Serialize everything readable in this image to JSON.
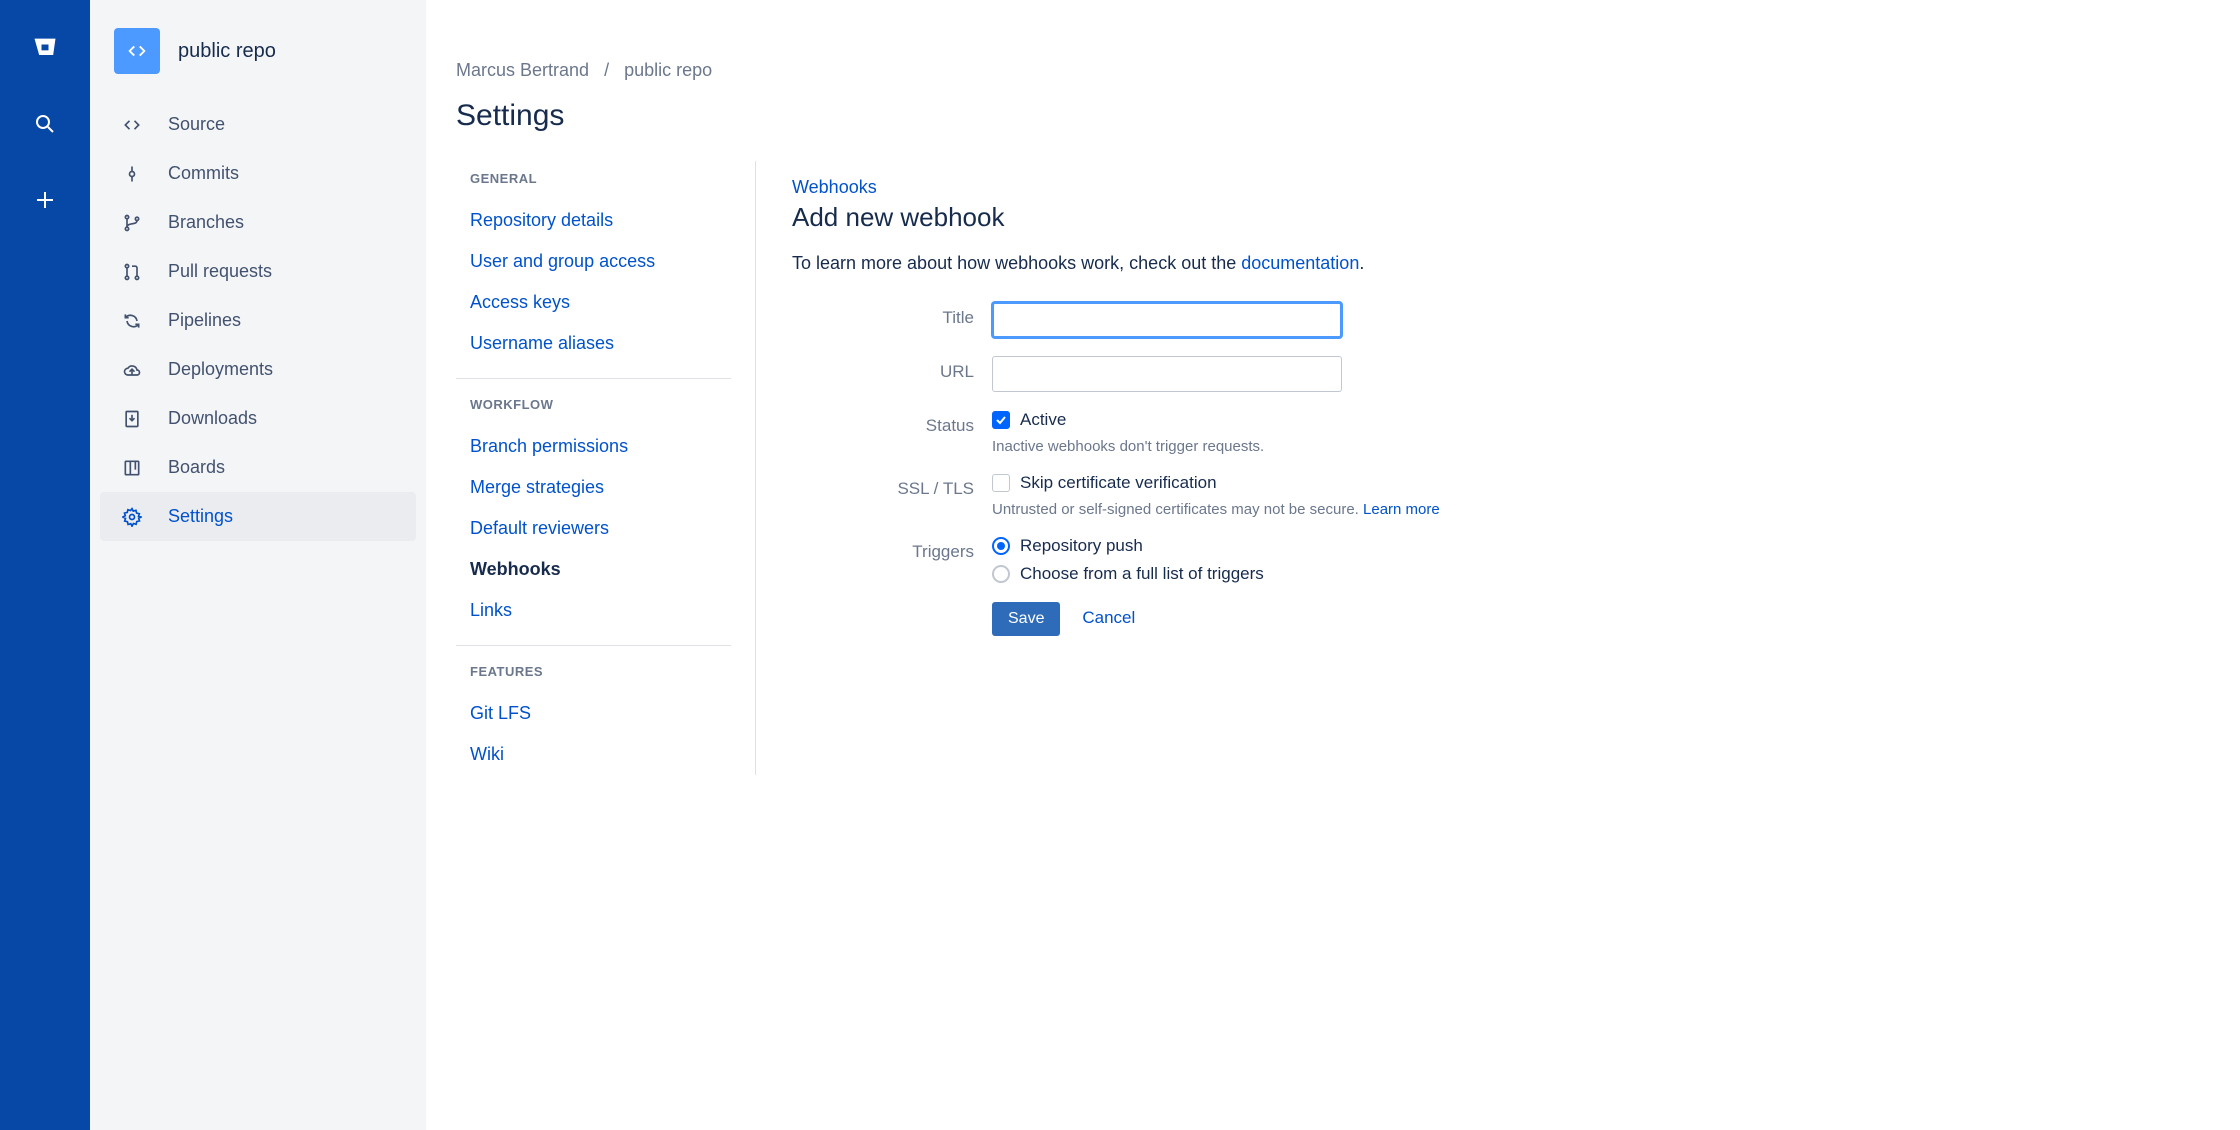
{
  "global_nav": {
    "logo": "bitbucket-logo",
    "items": [
      "search-icon",
      "plus-icon"
    ]
  },
  "repo": {
    "name": "public repo",
    "nav": [
      {
        "id": "source",
        "label": "Source",
        "icon": "code-icon"
      },
      {
        "id": "commits",
        "label": "Commits",
        "icon": "commit-icon"
      },
      {
        "id": "branches",
        "label": "Branches",
        "icon": "branch-icon"
      },
      {
        "id": "pullrequests",
        "label": "Pull requests",
        "icon": "pull-request-icon"
      },
      {
        "id": "pipelines",
        "label": "Pipelines",
        "icon": "pipeline-icon"
      },
      {
        "id": "deployments",
        "label": "Deployments",
        "icon": "cloud-upload-icon"
      },
      {
        "id": "downloads",
        "label": "Downloads",
        "icon": "download-icon"
      },
      {
        "id": "boards",
        "label": "Boards",
        "icon": "board-icon"
      },
      {
        "id": "settings",
        "label": "Settings",
        "icon": "gear-icon",
        "active": true
      }
    ]
  },
  "breadcrumb": {
    "owner": "Marcus Bertrand",
    "repo": "public repo"
  },
  "page_title": "Settings",
  "settings_nav": {
    "groups": [
      {
        "title": "GENERAL",
        "items": [
          {
            "id": "repo-details",
            "label": "Repository details"
          },
          {
            "id": "user-group-access",
            "label": "User and group access"
          },
          {
            "id": "access-keys",
            "label": "Access keys"
          },
          {
            "id": "username-aliases",
            "label": "Username aliases"
          }
        ]
      },
      {
        "title": "WORKFLOW",
        "items": [
          {
            "id": "branch-permissions",
            "label": "Branch permissions"
          },
          {
            "id": "merge-strategies",
            "label": "Merge strategies"
          },
          {
            "id": "default-reviewers",
            "label": "Default reviewers"
          },
          {
            "id": "webhooks",
            "label": "Webhooks",
            "current": true
          },
          {
            "id": "links",
            "label": "Links"
          }
        ]
      },
      {
        "title": "FEATURES",
        "items": [
          {
            "id": "git-lfs",
            "label": "Git LFS"
          },
          {
            "id": "wiki",
            "label": "Wiki"
          }
        ]
      }
    ]
  },
  "content": {
    "parent_link": "Webhooks",
    "heading": "Add new webhook",
    "help_prefix": "To learn more about how webhooks work, check out the ",
    "help_link": "documentation",
    "help_suffix": ".",
    "form": {
      "title_label": "Title",
      "title_value": "",
      "url_label": "URL",
      "url_value": "",
      "status_label": "Status",
      "status_option": "Active",
      "status_checked": true,
      "status_hint": "Inactive webhooks don't trigger requests.",
      "ssl_label": "SSL / TLS",
      "ssl_option": "Skip certificate verification",
      "ssl_checked": false,
      "ssl_hint_prefix": "Untrusted or self-signed certificates may not be secure. ",
      "ssl_hint_link": "Learn more",
      "triggers_label": "Triggers",
      "triggers_options": [
        {
          "id": "repo-push",
          "label": "Repository push",
          "selected": true
        },
        {
          "id": "full-list",
          "label": "Choose from a full list of triggers",
          "selected": false
        }
      ],
      "save_label": "Save",
      "cancel_label": "Cancel"
    }
  }
}
